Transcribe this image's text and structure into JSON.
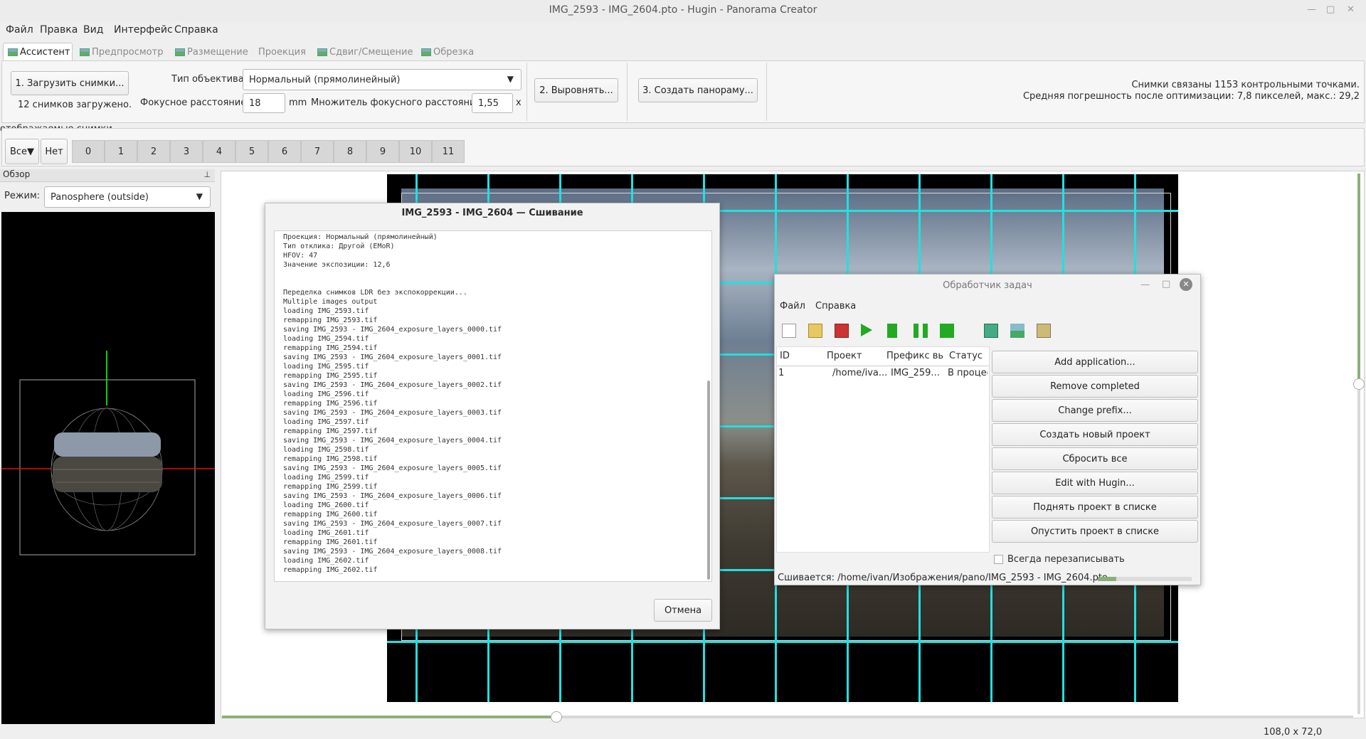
{
  "window": {
    "title": "IMG_2593 - IMG_2604.pto - Hugin - Panorama Creator"
  },
  "menu": [
    "Файл",
    "Правка",
    "Вид",
    "Интерфейс",
    "Справка"
  ],
  "tabs": [
    "Ассистент",
    "Предпросмотр",
    "Размещение",
    "Проекция",
    "Сдвиг/Смещение",
    "Обрезка"
  ],
  "assistant": {
    "load_label": "1. Загрузить снимки...",
    "loaded_text": "12 снимков загружено.",
    "lens_type_label": "Тип объектива:",
    "lens_type_value": "Нормальный (прямолинейный)",
    "focal_label": "Фокусное расстояние:",
    "focal_value": "18",
    "focal_unit": "mm",
    "crop_label": "Множитель фокусного расстояния:",
    "crop_value": "1,55",
    "crop_unit": "x",
    "align_label": "2. Выровнять...",
    "create_label": "3. Создать панораму...",
    "status_line1": "Снимки связаны 1153 контрольными точками.",
    "status_line2": "Средняя погрешность после оптимизации: 7,8 пикселей, макс.: 29,2"
  },
  "displayed": {
    "label": "отображаемые снимки",
    "all": "Все▼",
    "none": "Нет",
    "numbers": [
      "0",
      "1",
      "2",
      "3",
      "4",
      "5",
      "6",
      "7",
      "8",
      "9",
      "10",
      "11"
    ]
  },
  "overview": {
    "title": "Обзор",
    "mode_label": "Режим:",
    "mode_value": "Panosphere (outside)"
  },
  "status_bar": {
    "fov": "108,0 x 72,0"
  },
  "stitch_dialog": {
    "title": "IMG_2593 - IMG_2604 — Сшивание",
    "log": [
      "Проекция: Нормальный (прямолинейный)",
      "Тип отклика: Другой (EMoR)",
      "HFOV: 47",
      "Значение экспозиции: 12,6",
      "",
      "",
      "Переделка снимков LDR без экспокоррекции...",
      "Multiple images output",
      "loading IMG_2593.tif",
      "remapping IMG_2593.tif",
      "saving IMG_2593 - IMG_2604_exposure_layers_0000.tif",
      "loading IMG_2594.tif",
      "remapping IMG_2594.tif",
      "saving IMG_2593 - IMG_2604_exposure_layers_0001.tif",
      "loading IMG_2595.tif",
      "remapping IMG_2595.tif",
      "saving IMG_2593 - IMG_2604_exposure_layers_0002.tif",
      "loading IMG_2596.tif",
      "remapping IMG_2596.tif",
      "saving IMG_2593 - IMG_2604_exposure_layers_0003.tif",
      "loading IMG_2597.tif",
      "remapping IMG_2597.tif",
      "saving IMG_2593 - IMG_2604_exposure_layers_0004.tif",
      "loading IMG_2598.tif",
      "remapping IMG_2598.tif",
      "saving IMG_2593 - IMG_2604_exposure_layers_0005.tif",
      "loading IMG_2599.tif",
      "remapping IMG_2599.tif",
      "saving IMG_2593 - IMG_2604_exposure_layers_0006.tif",
      "loading IMG_2600.tif",
      "remapping IMG_2600.tif",
      "saving IMG_2593 - IMG_2604_exposure_layers_0007.tif",
      "loading IMG_2601.tif",
      "remapping IMG_2601.tif",
      "saving IMG_2593 - IMG_2604_exposure_layers_0008.tif",
      "loading IMG_2602.tif",
      "remapping IMG_2602.tif"
    ],
    "cancel": "Отмена"
  },
  "queue_dialog": {
    "title": "Обработчик задач",
    "menu": [
      "Файл",
      "Справка"
    ],
    "columns": [
      "ID",
      "Проект",
      "Префикс вы",
      "Статус"
    ],
    "row": {
      "id": "1",
      "project": "/home/iva...",
      "prefix": "IMG_259...",
      "status": "В процес"
    },
    "buttons": [
      "Add application...",
      "Remove completed",
      "Change prefix...",
      "Создать новый проект",
      "Сбросить все",
      "Edit with Hugin...",
      "Поднять проект в списке",
      "Опустить проект в списке"
    ],
    "overwrite": "Всегда перезаписывать",
    "status": "Сшивается: /home/ivan/Изображения/pano/IMG_2593 - IMG_2604.pto",
    "progress": 0.2
  }
}
